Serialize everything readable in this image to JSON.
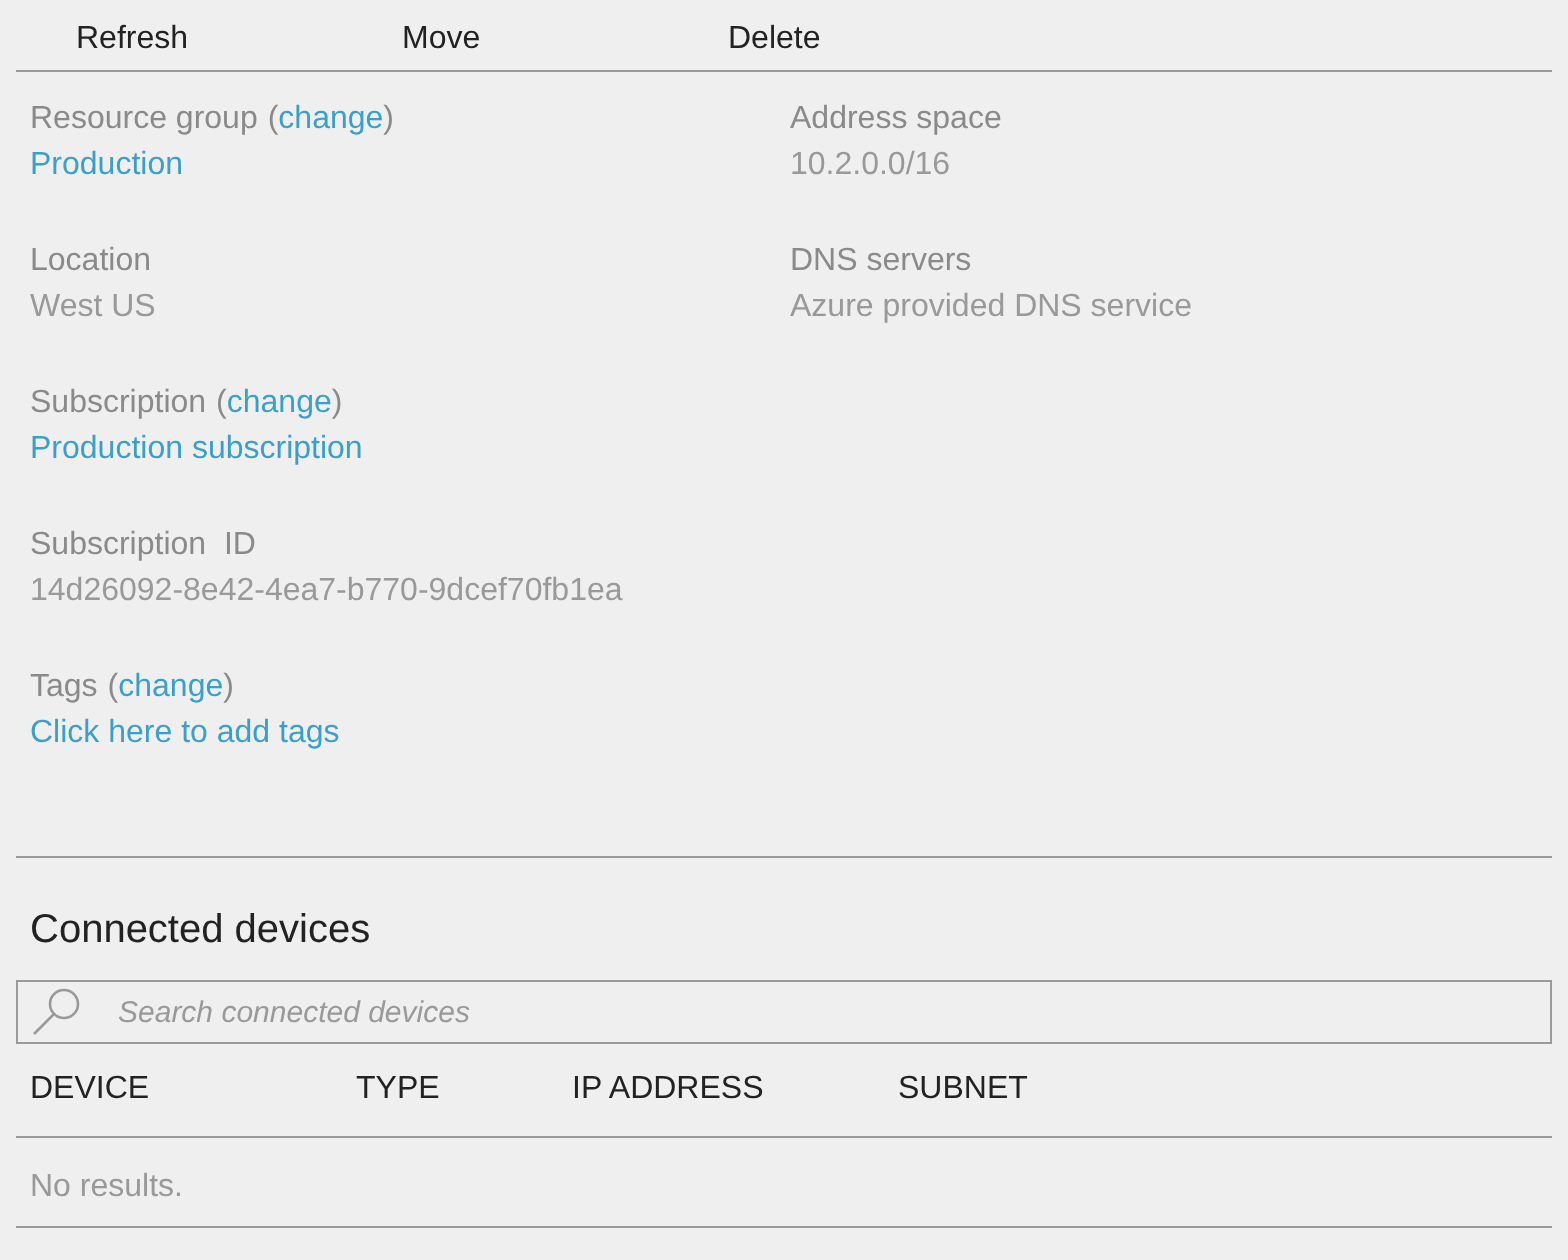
{
  "toolbar": [
    "Refresh",
    "Move",
    "Delete"
  ],
  "columns": [
    [
      {
        "kind": "link",
        "label": "Resource group",
        "change": {
          "open": "(",
          "text": "change",
          "close": ")"
        },
        "value": "Production"
      },
      {
        "kind": "plain",
        "label": "Location",
        "value": "West US"
      },
      {
        "kind": "link",
        "label": "Subscription",
        "change": {
          "open": "(",
          "text": "change",
          "close": ")"
        },
        "value": "Production subscription"
      },
      {
        "kind": "plain",
        "label": "Subscription  ID",
        "value": "14d26092-8e42-4ea7-b770-9dcef70fb1ea"
      },
      {
        "kind": "link",
        "label": "Tags",
        "change": {
          "open": "(",
          "text": "change",
          "close": ")"
        },
        "value": "Click here to add tags"
      }
    ],
    [
      {
        "kind": "plain",
        "label": "Address space",
        "value": "10.2.0.0/16"
      },
      {
        "kind": "plain",
        "label": "DNS servers",
        "value": "Azure provided DNS service"
      }
    ]
  ],
  "devices": {
    "title": "Connected devices",
    "search": {
      "placeholder": "Search connected devices"
    },
    "table": {
      "columns": [
        "DEVICE",
        "TYPE",
        "IP ADDRESS",
        "SUBNET"
      ],
      "empty": "No results."
    }
  }
}
